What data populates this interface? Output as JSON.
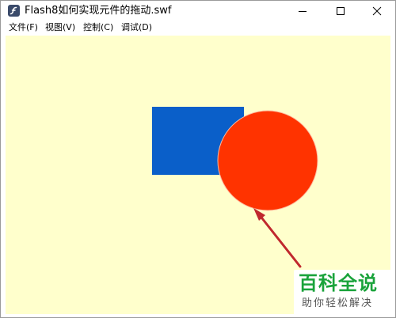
{
  "window": {
    "title": "Flash8如何实现元件的拖动.swf",
    "icon": "flash-player-icon"
  },
  "menubar": {
    "items": [
      "文件(F)",
      "视图(V)",
      "控制(C)",
      "调试(D)"
    ]
  },
  "stage": {
    "background": "#ffffcc",
    "rect_color": "#0a5fc9",
    "circle_color": "#ff3300",
    "arrow_color": "#c0282d"
  },
  "watermark": {
    "main": "百科全说",
    "sub": "助你轻松解决",
    "color": "#1aa33b"
  }
}
